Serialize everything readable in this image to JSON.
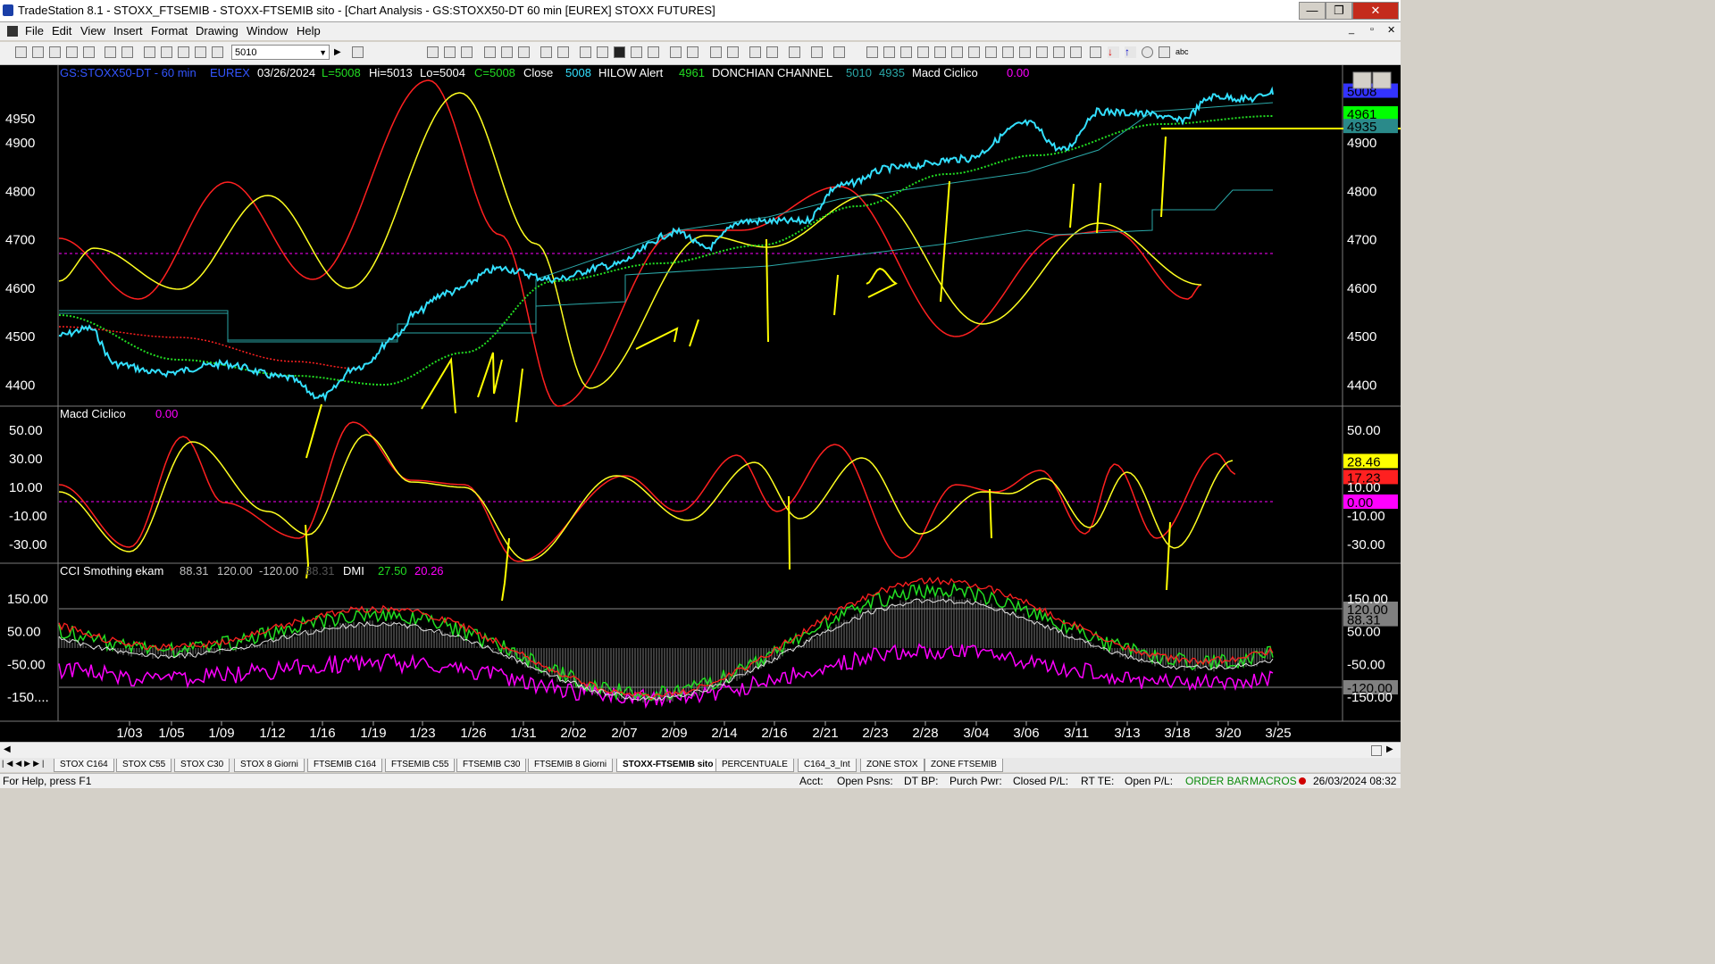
{
  "window": {
    "title": "TradeStation 8.1 - STOXX_FTSEMIB - STOXX-FTSEMIB sito - [Chart Analysis - GS:STOXX50-DT  60 min  [EUREX] STOXX FUTURES]",
    "min": "—",
    "max": "❐",
    "close": "✕"
  },
  "menu": [
    "File",
    "Edit",
    "View",
    "Insert",
    "Format",
    "Drawing",
    "Window",
    "Help"
  ],
  "toolbar": {
    "symbol_value": "5010"
  },
  "chart": {
    "header": {
      "symbol": "GS:STOXX50-DT - 60 min",
      "exchange": "EUREX",
      "date": "03/26/2024",
      "last": "L=5008",
      "high": "Hi=5013",
      "low": "Lo=5004",
      "close": "C=5008",
      "close_label": "Close",
      "close_value": "5008",
      "hilow_label": "HILOW Alert",
      "hilow_value": "4961",
      "donchian_label": "DONCHIAN CHANNEL",
      "donchian_upper": "5010",
      "donchian_lower": "4935",
      "macd_label": "Macd Ciclico",
      "macd_value": "0.00"
    },
    "panel1": {
      "y_ticks": [
        "4950",
        "4900",
        "4800",
        "4700",
        "4600",
        "4500",
        "4400"
      ],
      "y_values": [
        4950,
        4900,
        4800,
        4700,
        4600,
        4500,
        4400
      ],
      "right_ticks": [
        "4900",
        "4800",
        "4700",
        "4600",
        "4500",
        "4400"
      ],
      "price_tags": [
        {
          "text": "5008",
          "bg": "#3333ff",
          "fg": "#000000",
          "value": 5008
        },
        {
          "text": "4961",
          "bg": "#00ff00",
          "fg": "#000000",
          "value": 4961
        },
        {
          "text": "4935",
          "bg": "#2a8a8a",
          "fg": "#000000",
          "value": 4935
        }
      ]
    },
    "panel2": {
      "label": "Macd Ciclico",
      "value": "0.00",
      "y_ticks": [
        "50.00",
        "30.00",
        "10.00",
        "-10.00",
        "-30.00"
      ],
      "y_values": [
        50,
        30,
        10,
        -10,
        -30
      ],
      "right_ticks": [
        "50.00",
        "10.00",
        "-10.00",
        "-30.00"
      ],
      "tags": [
        {
          "text": "28.46",
          "bg": "#ffff00",
          "fg": "#000000",
          "value": 28.46
        },
        {
          "text": "17.23",
          "bg": "#ff2020",
          "fg": "#000000",
          "value": 17.23
        },
        {
          "text": "0.00",
          "bg": "#ff00ff",
          "fg": "#000000",
          "value": 0.0
        }
      ]
    },
    "panel3": {
      "cci_label": "CCI Smothing ekam",
      "cci_value": "88.31",
      "upper": "120.00",
      "lower": "-120.00",
      "ghost": "88.31",
      "dmi_label": "DMI",
      "dmi_plus": "27.50",
      "dmi_minus": "20.26",
      "y_ticks": [
        "150.00",
        "50.00",
        "-50.00",
        "-150...."
      ],
      "y_values": [
        150,
        50,
        -50,
        -150
      ],
      "right_ticks": [
        "150.00",
        "50.00",
        "-50.00",
        "-150.00"
      ],
      "tags": [
        {
          "text": "120.00",
          "bg": "#808080",
          "fg": "#000000",
          "value": 120
        },
        {
          "text": "88.31",
          "bg": "#808080",
          "fg": "#000000",
          "value": 88.31
        },
        {
          "text": "-120.00",
          "bg": "#808080",
          "fg": "#000000",
          "value": -120
        }
      ]
    },
    "x_labels": [
      "1/03",
      "1/05",
      "1/09",
      "1/12",
      "1/16",
      "1/19",
      "1/23",
      "1/26",
      "1/31",
      "2/02",
      "2/07",
      "2/09",
      "2/14",
      "2/16",
      "2/21",
      "2/23",
      "2/28",
      "3/04",
      "3/06",
      "3/11",
      "3/13",
      "3/18",
      "3/20",
      "3/25"
    ],
    "colors": {
      "price": "#33e0ff",
      "red": "#ff2020",
      "yellow": "#ffff20",
      "green": "#22dd22",
      "magenta": "#ff00ff",
      "teal": "#2aa8a8",
      "grey": "#c0c0c0",
      "drawing": "#ffff00"
    }
  },
  "tabs": [
    "STOX C164",
    "STOX C55",
    "STOX  C30",
    "STOX  8 Giorni",
    "FTSEMIB C164",
    "FTSEMIB C55",
    "FTSEMIB C30",
    "FTSEMIB  8 Giorni",
    "STOXX-FTSEMIB sito",
    "PERCENTUALE",
    "C164_3_Int",
    "ZONE STOX",
    "ZONE FTSEMIB"
  ],
  "active_tab": "STOXX-FTSEMIB sito",
  "status": {
    "help": "For Help, press F1",
    "acct": "Acct:",
    "open_psns": "Open Psns:",
    "dt_bp": "DT BP:",
    "purch_pwr": "Purch Pwr:",
    "closed_pl": "Closed P/L:",
    "rt_te": "RT TE:",
    "open_pl": "Open P/L:",
    "order_bar": "ORDER BAR",
    "macros": "MACROS",
    "datetime": "26/03/2024 08:32"
  }
}
